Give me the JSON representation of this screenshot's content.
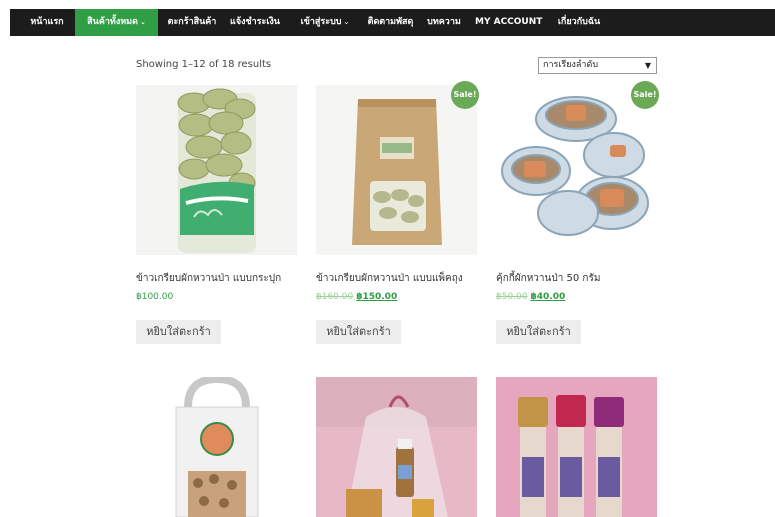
{
  "nav": {
    "items": [
      {
        "label": "หน้าแรก",
        "active": false,
        "dropdown": false
      },
      {
        "label": "สินค้าทั้งหมด",
        "active": true,
        "dropdown": true
      },
      {
        "label": "ตะกร้าสินค้า",
        "active": false,
        "dropdown": false
      },
      {
        "label": "แจ้งชำระเงิน",
        "active": false,
        "dropdown": false
      },
      {
        "label": "เข้าสู่ระบบ",
        "active": false,
        "dropdown": true
      },
      {
        "label": "ติดตามพัสดุ",
        "active": false,
        "dropdown": false
      },
      {
        "label": "บทความ",
        "active": false,
        "dropdown": false
      },
      {
        "label": "MY ACCOUNT",
        "active": false,
        "dropdown": false
      },
      {
        "label": "เกี่ยวกับฉัน",
        "active": false,
        "dropdown": false
      }
    ],
    "dropdown_caret": "⌄"
  },
  "shop": {
    "result_count": "Showing 1–12 of 18 results",
    "sort_selected": "การเรียงลำดับ",
    "sort_arrow": "▼"
  },
  "products": [
    {
      "title": "ข้าวเกรียบผักหวานป่า แบบกระปุก",
      "price": "฿100.00",
      "sale": false,
      "add_label": "หยิบใส่ตะกร้า"
    },
    {
      "title": "ข้าวเกรียบผักหวานป่า แบบแพ็คถุง",
      "old_price": "฿160.00",
      "new_price": "฿150.00",
      "sale": true,
      "sale_label": "Sale!",
      "add_label": "หยิบใส่ตะกร้า"
    },
    {
      "title": "คุ้กกี้ผักหวานป่า 50 กรัม",
      "old_price": "฿50.00",
      "new_price": "฿40.00",
      "sale": true,
      "sale_label": "Sale!",
      "add_label": "หยิบใส่ตะกร้า"
    }
  ],
  "colors": {
    "accent": "#2f9e44",
    "nav_bg": "#1c1c1c",
    "sale_badge": "#6aaa57",
    "button_bg": "#ededed"
  },
  "icons": {
    "sort": "dropdown-arrow-icon",
    "nav_caret": "chevron-down-icon"
  }
}
